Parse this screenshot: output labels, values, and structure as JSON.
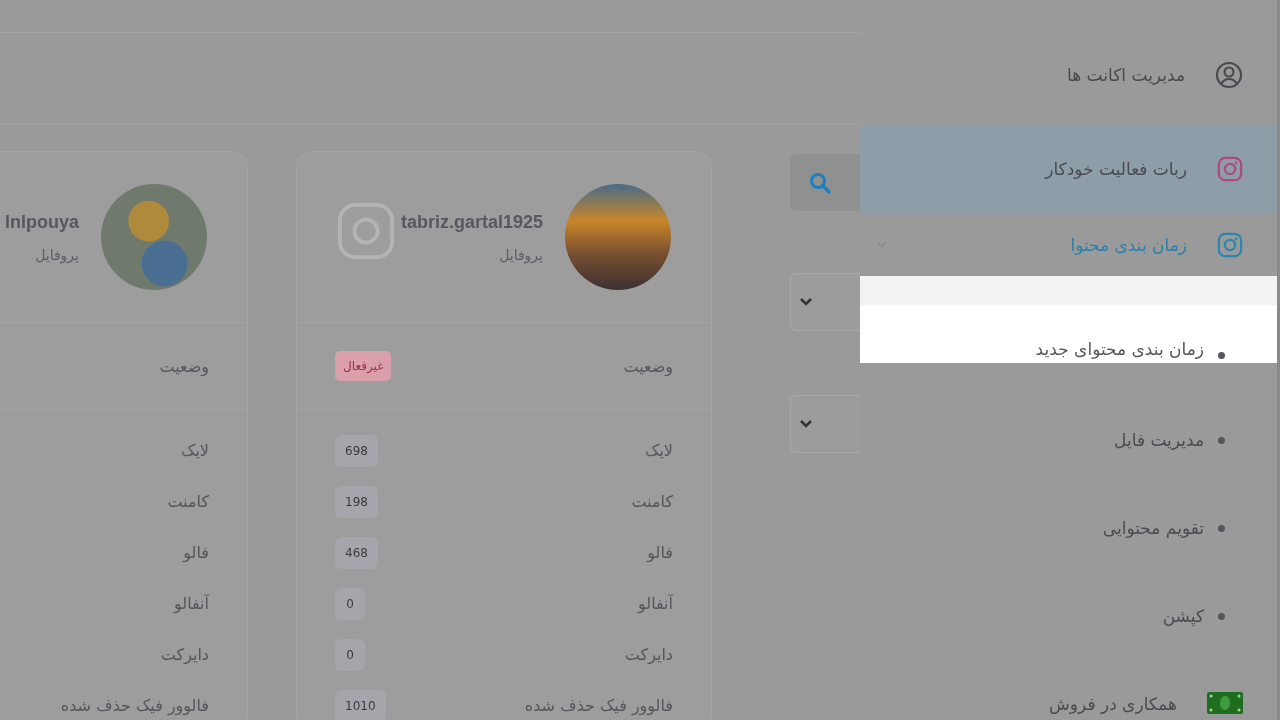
{
  "sidebar": {
    "items": [
      {
        "label": "مدیریت اکانت ها",
        "selected": false
      },
      {
        "label": "ربات فعالیت خودکار",
        "selected": true
      },
      {
        "label": "زمان بندی محتوا",
        "selected": false,
        "expanded": true,
        "children": [
          {
            "label": "زمان بندی محتوای جدید",
            "highlighted": true
          },
          {
            "label": "مدیریت فایل",
            "highlighted": false
          },
          {
            "label": "تقویم محتوایی",
            "highlighted": false
          },
          {
            "label": "کپشن",
            "highlighted": false
          }
        ]
      },
      {
        "label": "همکاری در فروش",
        "selected": false
      }
    ]
  },
  "accounts": [
    {
      "username": "tabriz.gartal1925",
      "subtitle": "پروفایل",
      "status_label": "وضعیت",
      "status": "غیرفعال",
      "active": false,
      "stats": [
        {
          "label": "لایک",
          "value": "698"
        },
        {
          "label": "کامنت",
          "value": "198"
        },
        {
          "label": "فالو",
          "value": "468"
        },
        {
          "label": "آنفالو",
          "value": "0"
        },
        {
          "label": "دایرکت",
          "value": "0"
        },
        {
          "label": "فالوور فیک حذف شده",
          "value": "1010"
        }
      ]
    },
    {
      "username": "lnlpouya",
      "subtitle": "پروفایل",
      "status_label": "وضعیت",
      "stats": [
        {
          "label": "لایک"
        },
        {
          "label": "کامنت"
        },
        {
          "label": "فالو"
        },
        {
          "label": "آنفالو"
        },
        {
          "label": "دایرکت"
        },
        {
          "label": "فالوور فیک حذف شده"
        }
      ]
    }
  ]
}
